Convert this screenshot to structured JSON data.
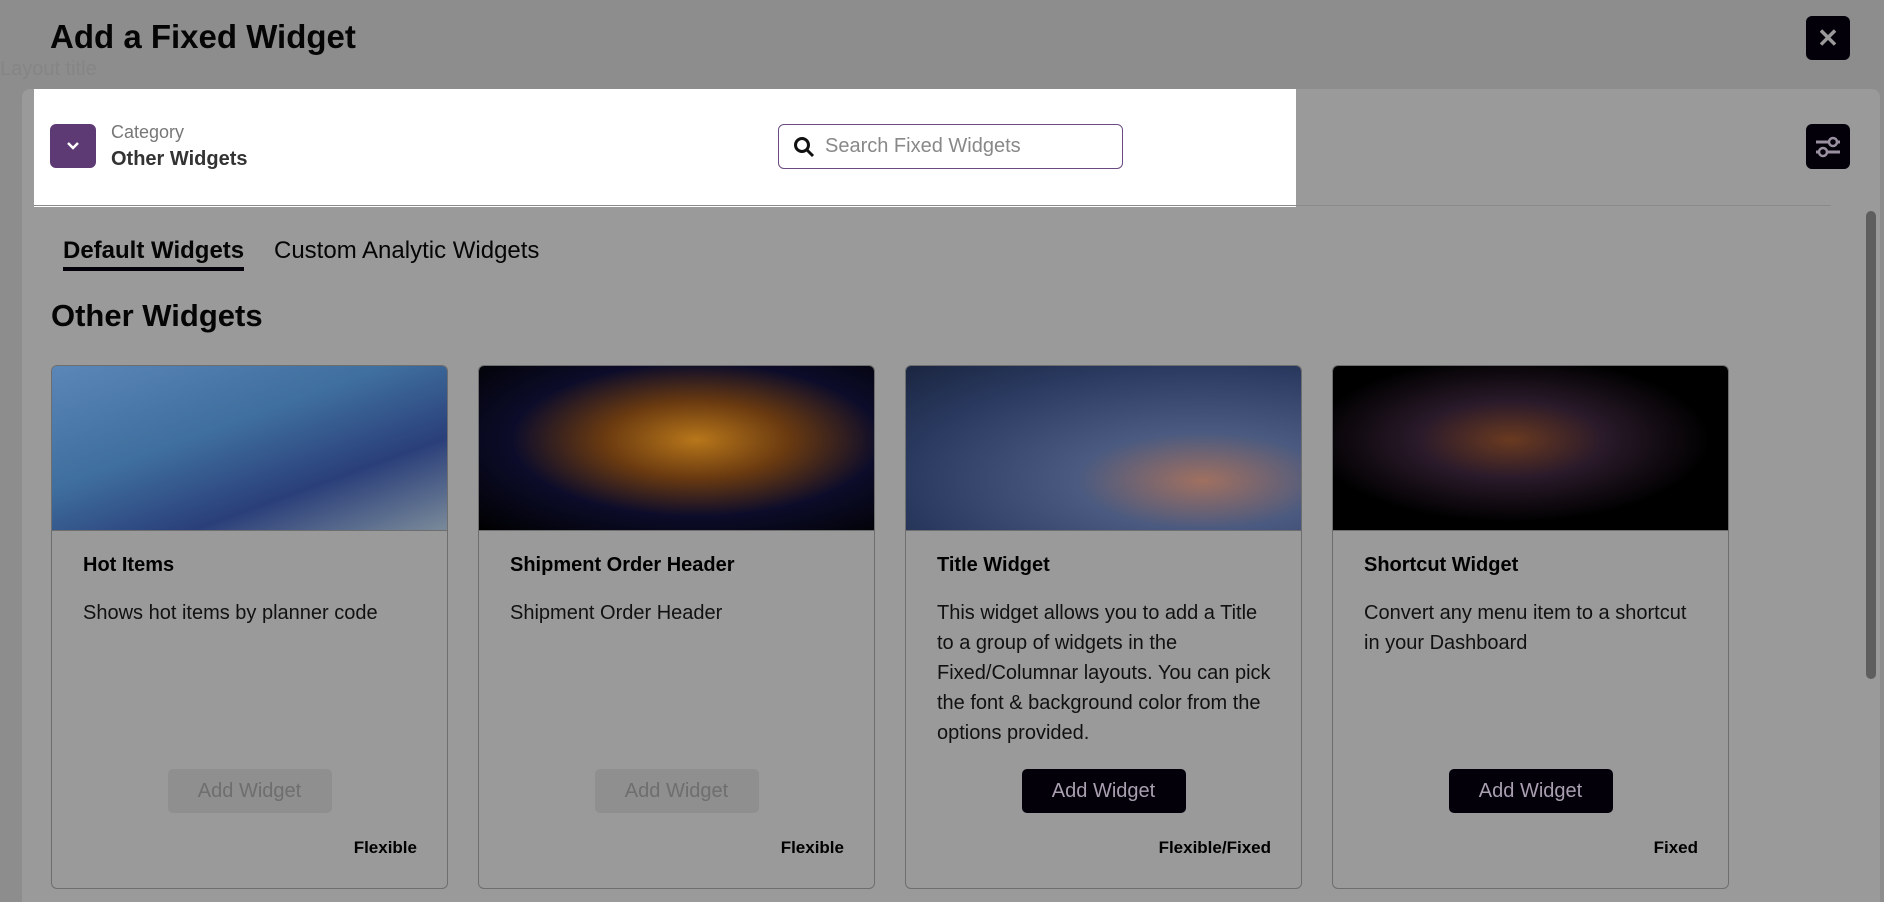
{
  "background": {
    "layout_title": "Layout title"
  },
  "modal": {
    "title": "Add a Fixed Widget",
    "close_icon": "close-icon"
  },
  "category": {
    "label": "Category",
    "value": "Other Widgets"
  },
  "search": {
    "placeholder": "Search Fixed Widgets",
    "value": ""
  },
  "tabs": [
    {
      "label": "Default Widgets",
      "active": true
    },
    {
      "label": "Custom Analytic Widgets",
      "active": false
    }
  ],
  "section_title": "Other Widgets",
  "colors": {
    "accent": "#5e3a74",
    "dark_button": "#03000a"
  },
  "cards": [
    {
      "title": "Hot Items",
      "description": "Shows hot items by planner code",
      "button": "Add Widget",
      "enabled": false,
      "layout": "Flexible"
    },
    {
      "title": "Shipment Order Header",
      "description": "Shipment Order Header",
      "button": "Add Widget",
      "enabled": false,
      "layout": "Flexible"
    },
    {
      "title": "Title Widget",
      "description": "This widget allows you to add a Title to a group of widgets in the Fixed/Columnar layouts. You can pick the font & background color from the options provided.",
      "button": "Add Widget",
      "enabled": true,
      "layout": "Flexible/Fixed"
    },
    {
      "title": "Shortcut Widget",
      "description": "Convert any menu item to a shortcut in your Dashboard",
      "button": "Add Widget",
      "enabled": true,
      "layout": "Fixed"
    }
  ]
}
